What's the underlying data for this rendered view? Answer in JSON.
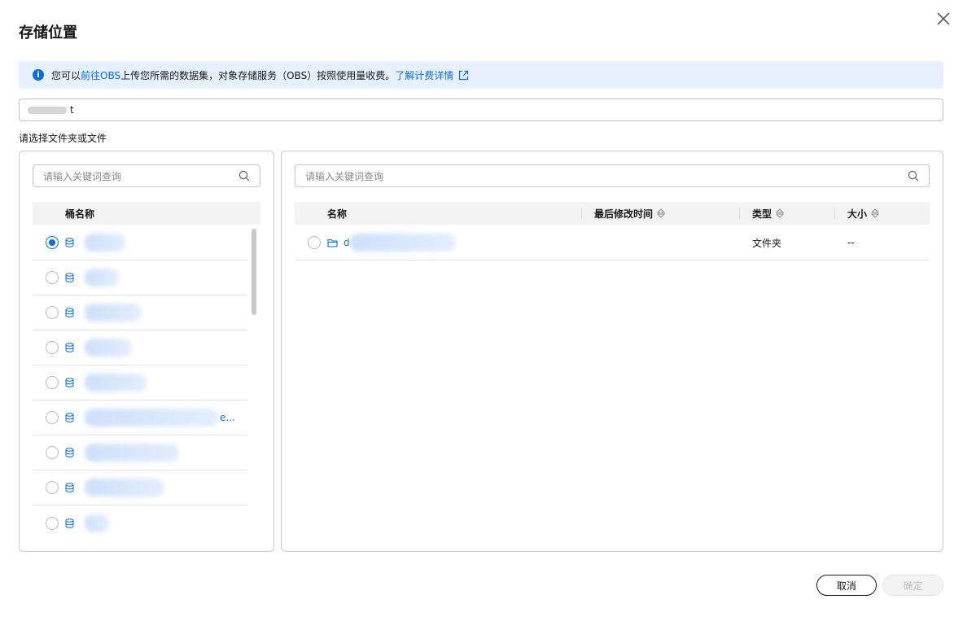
{
  "dialog": {
    "title": "存储位置",
    "close_icon": "close-icon"
  },
  "banner": {
    "info_icon": "info-icon",
    "text_prefix": "您可以",
    "link_obs": "前往OBS",
    "text_middle": "上传您所需的数据集，对象存储服务（OBS）按照使用量收费。",
    "link_billing": "了解计费详情",
    "external_icon": "external-link-icon"
  },
  "path_input": {
    "visible_suffix": "t"
  },
  "select_label": "请选择文件夹或文件",
  "left_panel": {
    "search_placeholder": "请输入关键词查询",
    "column_header": "桶名称",
    "selected_index": 0,
    "truncated_suffix": "e..."
  },
  "right_panel": {
    "search_placeholder": "请输入关键词查询",
    "columns": {
      "name": "名称",
      "modified": "最后修改时间",
      "type": "类型",
      "size": "大小"
    },
    "rows": [
      {
        "name_prefix": "d",
        "modified": "",
        "type": "文件夹",
        "size": "--"
      }
    ]
  },
  "footer": {
    "cancel_label": "取消",
    "ok_label": "确定"
  },
  "colors": {
    "accent": "#0b6dd9",
    "banner_bg": "#e6f0fe"
  }
}
